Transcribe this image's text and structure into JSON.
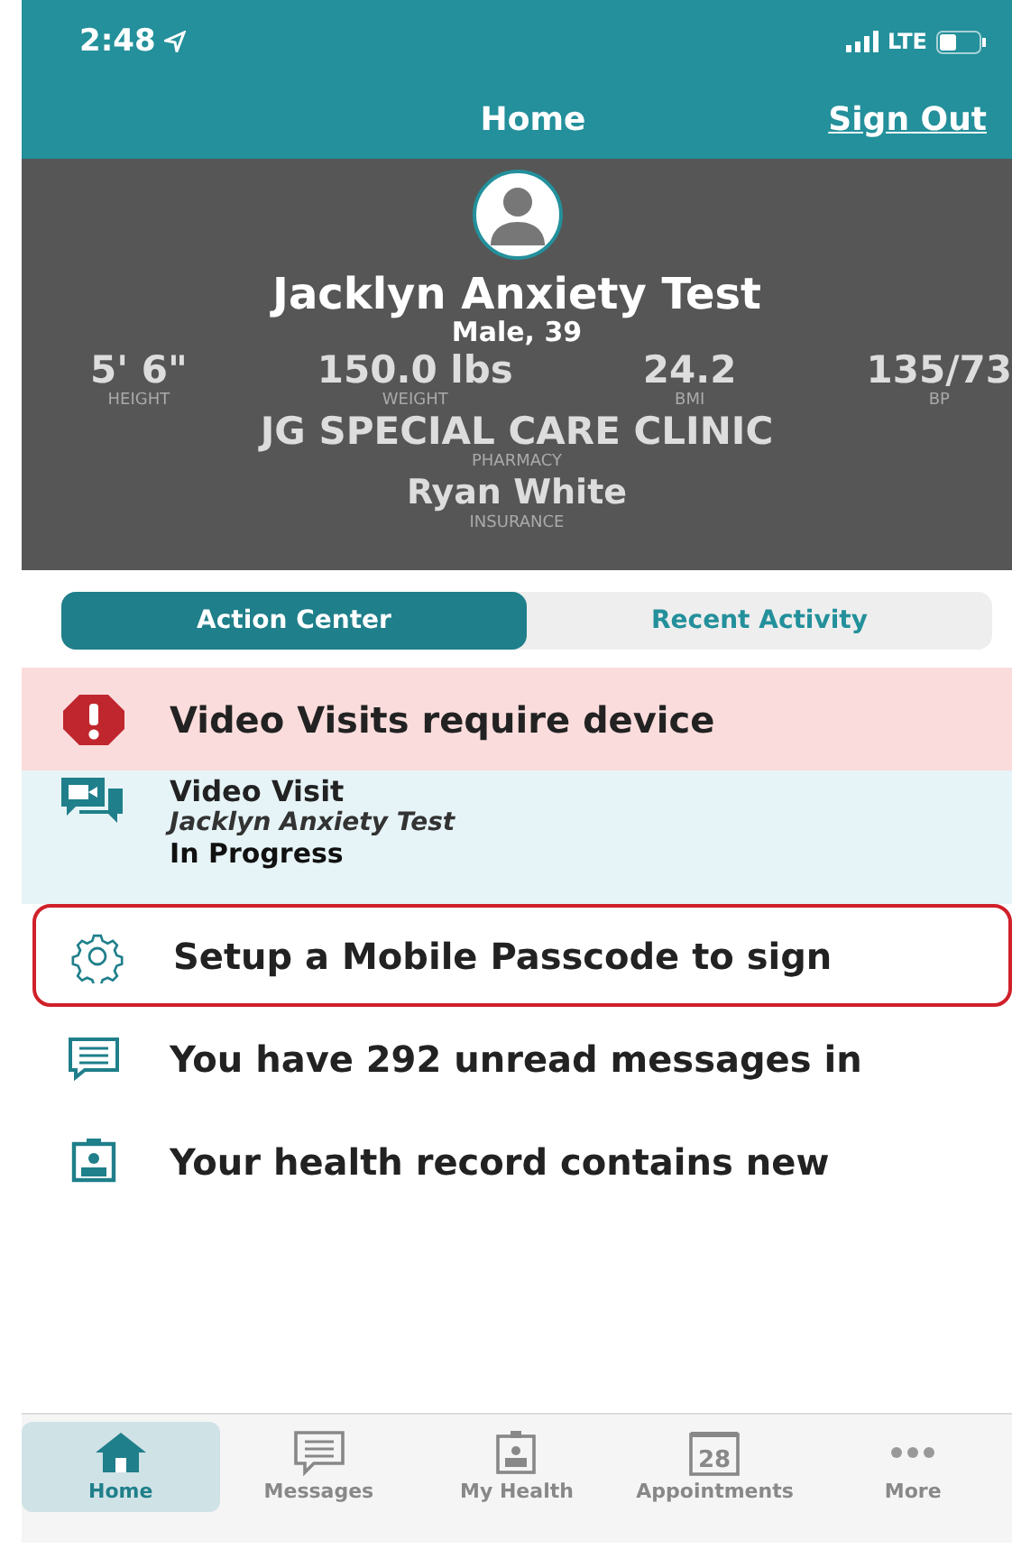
{
  "status_bar": {
    "time": "2:48",
    "network": "LTE"
  },
  "nav": {
    "title": "Home",
    "action": "Sign Out"
  },
  "profile": {
    "name": "Jacklyn Anxiety Test",
    "subtitle": "Male, 39",
    "stats": [
      {
        "value": "5' 6\"",
        "label": "HEIGHT"
      },
      {
        "value": "150.0 lbs",
        "label": "WEIGHT"
      },
      {
        "value": "24.2",
        "label": "BMI"
      },
      {
        "value": "135/73",
        "label": "BP"
      }
    ],
    "pharmacy": {
      "value": "JG SPECIAL CARE CLINIC",
      "label": "PHARMACY"
    },
    "insurance": {
      "value": "Ryan White",
      "label": "INSURANCE"
    }
  },
  "segments": [
    {
      "label": "Action Center",
      "selected": true
    },
    {
      "label": "Recent Activity",
      "selected": false
    }
  ],
  "actions": [
    {
      "kind": "alert",
      "text": "Video Visits require device",
      "highlighted": false
    },
    {
      "kind": "visit",
      "title": "Video Visit",
      "patient": "Jacklyn Anxiety Test",
      "status": "In Progress",
      "highlighted": false
    },
    {
      "kind": "setup",
      "text": "Setup a Mobile Passcode to sign",
      "highlighted": true
    },
    {
      "kind": "message",
      "text": "You have 292 unread messages in",
      "highlighted": false
    },
    {
      "kind": "record",
      "text": "Your health record contains new",
      "highlighted": false
    }
  ],
  "tab_bar": [
    {
      "kind": "home",
      "label": "Home",
      "selected": true
    },
    {
      "kind": "messages",
      "label": "Messages",
      "selected": false
    },
    {
      "kind": "health",
      "label": "My Health",
      "selected": false
    },
    {
      "kind": "calendar",
      "label": "Appointments",
      "day": "28",
      "selected": false
    },
    {
      "kind": "more",
      "label": "More",
      "selected": false
    }
  ]
}
